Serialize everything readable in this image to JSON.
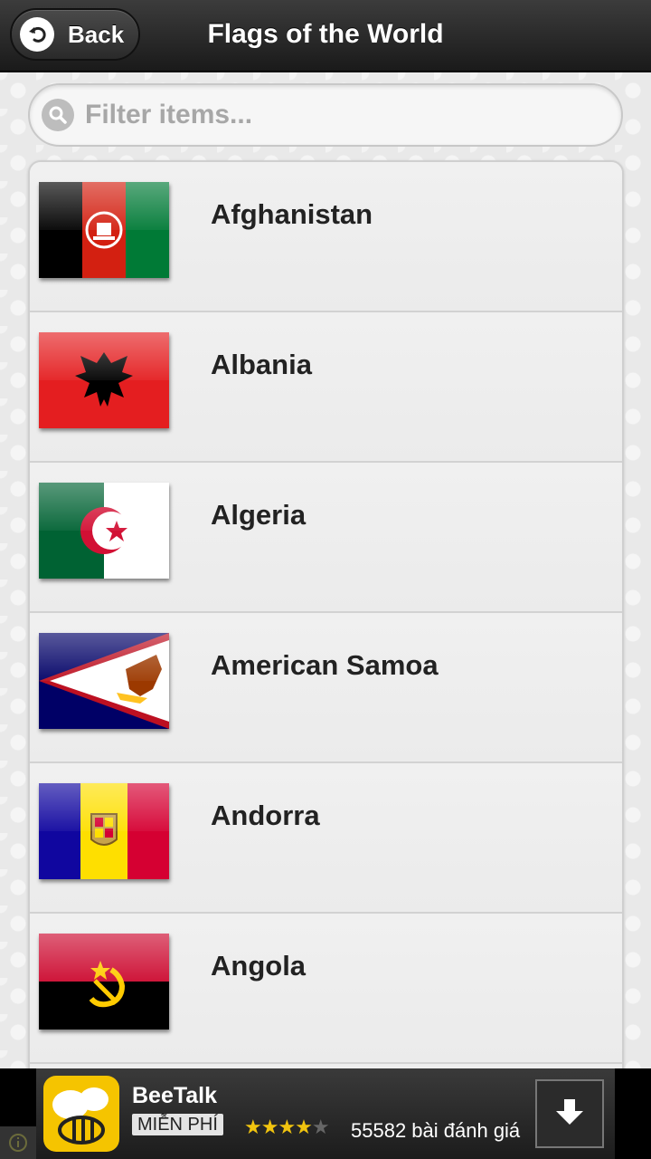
{
  "header": {
    "back_label": "Back",
    "title": "Flags of the World"
  },
  "search": {
    "placeholder": "Filter items..."
  },
  "countries": [
    {
      "name": "Afghanistan",
      "flag": "afghanistan-flag-icon"
    },
    {
      "name": "Albania",
      "flag": "albania-flag-icon"
    },
    {
      "name": "Algeria",
      "flag": "algeria-flag-icon"
    },
    {
      "name": "American Samoa",
      "flag": "american-samoa-flag-icon"
    },
    {
      "name": "Andorra",
      "flag": "andorra-flag-icon"
    },
    {
      "name": "Angola",
      "flag": "angola-flag-icon"
    }
  ],
  "ad": {
    "app_name": "BeeTalk",
    "price_badge": "MIỄN PHÍ",
    "rating_stars": 4,
    "reviews": "55582 bài đánh giá",
    "icon": "beetalk-app-icon",
    "download_icon": "download-arrow-icon"
  },
  "colors": {
    "header_bg": "#2a2a2a",
    "list_bg": "#ededed",
    "text": "#222222",
    "ad_star": "#f1c40f"
  }
}
